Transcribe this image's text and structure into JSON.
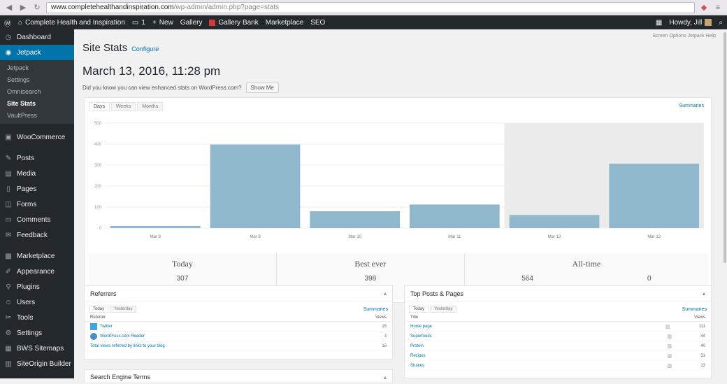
{
  "browser": {
    "url_host": "www.completehealthandinspiration.com",
    "url_path": "/wp-admin/admin.php?page=stats"
  },
  "adminbar": {
    "site_name": "Complete Health and Inspiration",
    "comments_count": "1",
    "new_label": "New",
    "gallery_label": "Gallery",
    "gallery_bank_label": "Gallery Bank",
    "marketplace_label": "Marketplace",
    "seo_label": "SEO",
    "howdy": "Howdy, Jill"
  },
  "sidebar": {
    "items": [
      {
        "label": "Dashboard",
        "icon": "dashboard-icon"
      },
      {
        "label": "Jetpack",
        "icon": "jetpack-icon",
        "active": true
      },
      {
        "label": "WooCommerce",
        "icon": "woocommerce-icon"
      },
      {
        "label": "Posts",
        "icon": "pin-icon"
      },
      {
        "label": "Media",
        "icon": "media-icon"
      },
      {
        "label": "Pages",
        "icon": "page-icon"
      },
      {
        "label": "Forms",
        "icon": "forms-icon"
      },
      {
        "label": "Comments",
        "icon": "comment-icon"
      },
      {
        "label": "Feedback",
        "icon": "feedback-icon"
      },
      {
        "label": "Marketplace",
        "icon": "marketplace-icon"
      },
      {
        "label": "Appearance",
        "icon": "brush-icon"
      },
      {
        "label": "Plugins",
        "icon": "plugin-icon"
      },
      {
        "label": "Users",
        "icon": "users-icon"
      },
      {
        "label": "Tools",
        "icon": "tools-icon"
      },
      {
        "label": "Settings",
        "icon": "settings-icon"
      },
      {
        "label": "BWS Sitemaps",
        "icon": "sitemap-icon"
      },
      {
        "label": "SiteOrigin Builder",
        "icon": "builder-icon"
      }
    ],
    "submenu": [
      "Jetpack",
      "Settings",
      "Omnisearch",
      "Site Stats",
      "VaultPress"
    ]
  },
  "main": {
    "screen_options": "Screen Options  Jetpack Help",
    "title": "Site Stats",
    "configure": "Configure",
    "date_title": "March 13, 2016, 11:28 pm",
    "notice": "Did you know you can view enhanced stats on WordPress.com?",
    "notice_button": "Show Me",
    "tabs": [
      "Days",
      "Weeks",
      "Months"
    ],
    "summaries": "Summaries",
    "totals": {
      "today_label": "Today",
      "today_value": "307",
      "today_unit": "views",
      "best_label": "Best ever",
      "best_value": "398",
      "best_unit": "views",
      "alltime_label": "All-time",
      "alltime_views": "564",
      "alltime_views_unit": "views",
      "alltime_comments": "0",
      "alltime_comments_unit": "comments"
    }
  },
  "referrers": {
    "title": "Referrers",
    "tabs": [
      "Today",
      "Yesterday"
    ],
    "summaries": "Summaries",
    "col_left": "Referrer",
    "col_right": "Views",
    "rows": [
      {
        "label": "Twitter",
        "value": "15",
        "icon": "twitter-icon"
      },
      {
        "label": "WordPress.com Reader",
        "value": "3",
        "icon": "wordpress-icon"
      }
    ],
    "total_link": "Total views referred by links to your blog",
    "total_value": "18"
  },
  "searchterms": {
    "title": "Search Engine Terms"
  },
  "topposts": {
    "title": "Top Posts & Pages",
    "tabs": [
      "Today",
      "Yesterday"
    ],
    "summaries": "Summaries",
    "col_left": "Title",
    "col_right": "Views",
    "rows": [
      {
        "label": "Home page",
        "value": "111"
      },
      {
        "label": "Superfoods",
        "value": "44"
      },
      {
        "label": "Protein",
        "value": "40"
      },
      {
        "label": "Recipes",
        "value": "31"
      },
      {
        "label": "Shakes",
        "value": "13"
      }
    ]
  },
  "chart_data": {
    "type": "bar",
    "categories": [
      "Mar 8",
      "Mar 9",
      "Mar 10",
      "Mar 11",
      "Mar 12",
      "Mar 13"
    ],
    "values": [
      10,
      398,
      80,
      112,
      62,
      307
    ],
    "ylim": [
      0,
      500
    ],
    "yticks": [
      "0",
      "100",
      "200",
      "300",
      "400",
      "500"
    ],
    "bar_color": "#8fb8cc",
    "highlight_last_two": true
  }
}
